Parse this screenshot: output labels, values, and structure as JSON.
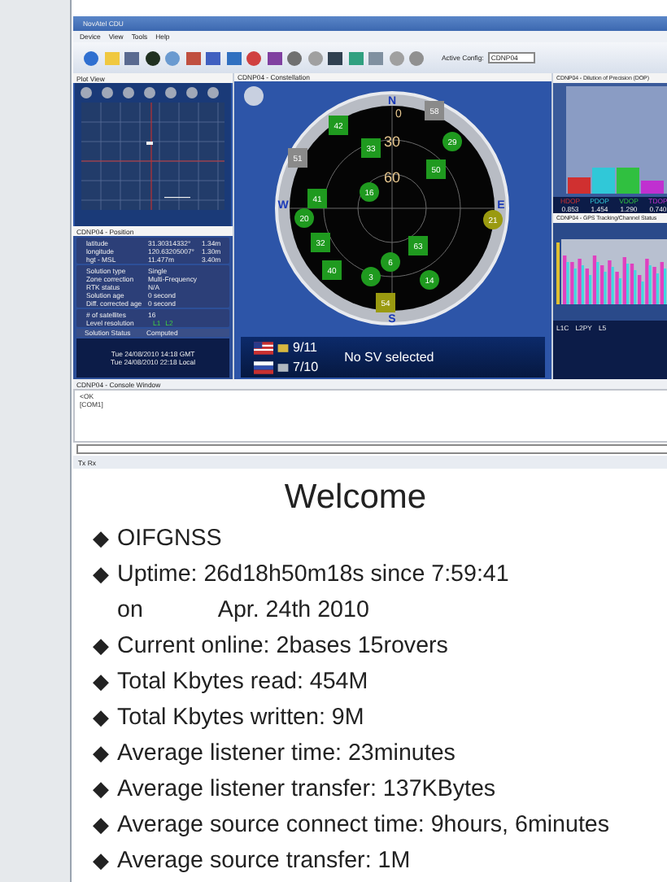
{
  "app": {
    "title": "NovAtel CDU",
    "menu": [
      "Device",
      "View",
      "Tools",
      "Help"
    ],
    "config_label": "Active Config:",
    "config_value": "CDNP04",
    "plot_view": {
      "title": "Plot View"
    },
    "position": {
      "title": "CDNP04 - Position",
      "coordinates": [
        {
          "label": "latitude",
          "value": "31.30314332°",
          "error": "1.34m"
        },
        {
          "label": "longitude",
          "value": "120.63205007°",
          "error": "1.30m"
        },
        {
          "label": "hgt - MSL",
          "value": "11.477m",
          "error": "3.40m"
        }
      ],
      "details": [
        {
          "label": "Solution type",
          "value": "Single"
        },
        {
          "label": "Zone correction",
          "value": "Multi-Frequency"
        },
        {
          "label": "RTK status",
          "value": "N/A"
        },
        {
          "label": "Solution age",
          "value": "0 second"
        },
        {
          "label": "Diff. corrected age",
          "value": "0 second"
        }
      ],
      "satellites_label": "# of satellites",
      "satellites_value": "16",
      "level_label": "Level resolution",
      "signals": [
        "L1",
        "L2"
      ],
      "status_label": "Solution Status",
      "status_value": "Computed",
      "times": [
        "Tue 24/08/2010 14:18 GMT",
        "Tue 24/08/2010 22:18 Local"
      ]
    },
    "constellation": {
      "title": "CDNP04 - Constellation",
      "compass": [
        "N",
        "E",
        "S",
        "W"
      ],
      "rings": [
        "0",
        "30",
        "60"
      ],
      "satellites": [
        {
          "label": "42",
          "kind": "square",
          "color": "#1f9a1f"
        },
        {
          "label": "58",
          "kind": "square",
          "color": "#8a8a8a"
        },
        {
          "label": "29",
          "kind": "circle",
          "color": "#1f9a1f"
        },
        {
          "label": "33",
          "kind": "square",
          "color": "#1f9a1f"
        },
        {
          "label": "51",
          "kind": "square",
          "color": "#8a8a8a"
        },
        {
          "label": "50",
          "kind": "square",
          "color": "#1f9a1f"
        },
        {
          "label": "16",
          "kind": "circle",
          "color": "#1f9a1f"
        },
        {
          "label": "41",
          "kind": "square",
          "color": "#1f9a1f"
        },
        {
          "label": "20",
          "kind": "circle",
          "color": "#1f9a1f"
        },
        {
          "label": "21",
          "kind": "circle",
          "color": "#9a9a10"
        },
        {
          "label": "32",
          "kind": "square",
          "color": "#1f9a1f"
        },
        {
          "label": "63",
          "kind": "square",
          "color": "#1f9a1f"
        },
        {
          "label": "40",
          "kind": "square",
          "color": "#1f9a1f"
        },
        {
          "label": "6",
          "kind": "circle",
          "color": "#1f9a1f"
        },
        {
          "label": "3",
          "kind": "circle",
          "color": "#1f9a1f"
        },
        {
          "label": "14",
          "kind": "circle",
          "color": "#1f9a1f"
        },
        {
          "label": "54",
          "kind": "square",
          "color": "#9a9a10"
        }
      ],
      "gps_count": "9/11",
      "glonass_count": "7/10",
      "selection": "No SV selected"
    },
    "dop": {
      "title": "CDNP04 - Dilution of Precision (DOP)",
      "values": [
        {
          "name": "HDOP",
          "reading": "0.853",
          "color": "#d03030"
        },
        {
          "name": "PDOP",
          "reading": "1.454",
          "color": "#30c8d8"
        },
        {
          "name": "VDOP",
          "reading": "1.290",
          "color": "#30c040"
        },
        {
          "name": "TDOP",
          "reading": "0.740",
          "color": "#c030d0"
        }
      ]
    },
    "tracking": {
      "title": "CDNP04 - GPS Tracking/Channel Status",
      "legend": [
        "L1C",
        "L2PY",
        "L5"
      ]
    },
    "console": {
      "title": "CDNP04 - Console Window",
      "lines": [
        "<OK",
        "[COM1]"
      ]
    },
    "status": "Tx  Rx"
  },
  "welcome": {
    "heading": "Welcome",
    "items": [
      {
        "bullet": "◆",
        "lines": [
          [
            "OIFGNSS"
          ]
        ]
      },
      {
        "bullet": "◆",
        "lines": [
          [
            "Uptime: 26d18h50m18s since 7:59:41"
          ],
          [
            "on",
            "Apr. 24th 2010"
          ]
        ]
      },
      {
        "bullet": "◆",
        "lines": [
          [
            "Current online: 2bases 15rovers"
          ]
        ]
      },
      {
        "bullet": "◆",
        "lines": [
          [
            "Total Kbytes read: 454M"
          ]
        ]
      },
      {
        "bullet": "◆",
        "lines": [
          [
            "Total Kbytes written: 9M"
          ]
        ]
      },
      {
        "bullet": "◆",
        "lines": [
          [
            "Average listener time: 23minutes"
          ]
        ]
      },
      {
        "bullet": "◆",
        "lines": [
          [
            "Average listener transfer: 137KBytes"
          ]
        ]
      },
      {
        "bullet": "◆",
        "lines": [
          [
            "Average source connect time: 9hours, 6minutes"
          ]
        ]
      },
      {
        "bullet": "◆",
        "lines": [
          [
            "Average source transfer: 1M"
          ]
        ]
      }
    ]
  }
}
